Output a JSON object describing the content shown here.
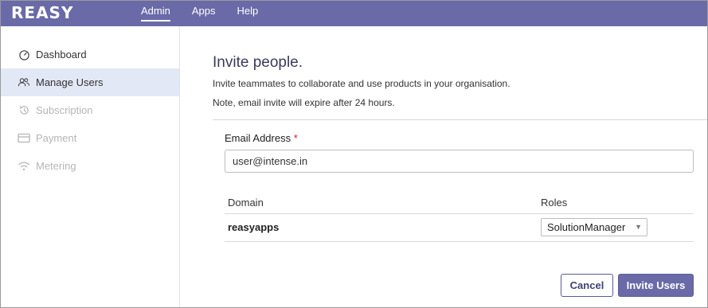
{
  "app": {
    "logo": "REASY"
  },
  "nav": {
    "items": [
      {
        "label": "Admin",
        "active": true
      },
      {
        "label": "Apps"
      },
      {
        "label": "Help"
      }
    ]
  },
  "sidebar": {
    "items": [
      {
        "label": "Dashboard",
        "icon": "dashboard-icon"
      },
      {
        "label": "Manage Users",
        "icon": "users-icon",
        "active": true
      },
      {
        "label": "Subscription",
        "icon": "history-icon",
        "disabled": true
      },
      {
        "label": "Payment",
        "icon": "credit-card-icon",
        "disabled": true
      },
      {
        "label": "Metering",
        "icon": "wifi-icon",
        "disabled": true
      }
    ]
  },
  "invite": {
    "title": "Invite people.",
    "description": "Invite teammates to collaborate and use products in your organisation.",
    "note": "Note, email invite will expire after 24 hours.",
    "email_label": "Email Address",
    "required_mark": "*",
    "email_value": "user@intense.in",
    "table": {
      "headers": {
        "domain": "Domain",
        "roles": "Roles"
      },
      "rows": [
        {
          "domain": "reasyapps",
          "role": "SolutionManager"
        }
      ]
    },
    "cancel_label": "Cancel",
    "submit_label": "Invite Users"
  },
  "colors": {
    "brand": "#6a6aa8",
    "active_bg": "#e3e8f7",
    "required": "#d0192b"
  }
}
